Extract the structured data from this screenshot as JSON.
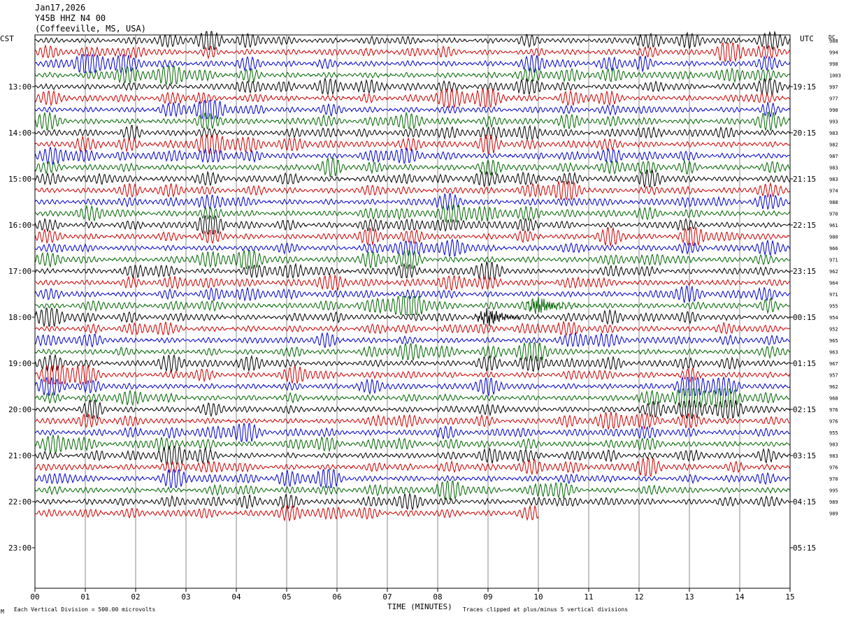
{
  "header": {
    "date": "Jan17,2026",
    "station": "Y45B HHZ N4 00",
    "location": "(Coffeeville, MS, USA)"
  },
  "footer": {
    "scale_note": "Each Vertical Division =  500.00 microvolts",
    "clip_note": "Traces clipped at plus/minus 5 vertical divisions",
    "corner_mark": "M"
  },
  "chart_data": {
    "type": "line",
    "title": "",
    "left_label": "CST",
    "right_label": "UTC",
    "dc_label": "DC",
    "xlabel": "TIME (MINUTES)",
    "xlim": [
      0,
      15
    ],
    "x_ticks": [
      "00",
      "01",
      "02",
      "03",
      "04",
      "05",
      "06",
      "07",
      "08",
      "09",
      "10",
      "11",
      "12",
      "13",
      "14",
      "15"
    ],
    "left_hour_labels": [
      "13:00",
      "14:00",
      "15:00",
      "16:00",
      "17:00",
      "18:00",
      "19:00",
      "20:00",
      "21:00",
      "22:00",
      "23:00"
    ],
    "right_hour_labels": [
      "19:15",
      "20:15",
      "21:15",
      "22:15",
      "23:15",
      "00:15",
      "01:15",
      "02:15",
      "03:15",
      "04:15",
      "05:15"
    ],
    "rows_per_hour": 4,
    "first_row_time": "12:00",
    "trace_colors": [
      "#000000",
      "#cc0000",
      "#0000cc",
      "#006600"
    ],
    "dc_offsets": [
      988,
      994,
      998,
      1003,
      997,
      977,
      990,
      993,
      983,
      982,
      987,
      983,
      983,
      974,
      988,
      970,
      961,
      980,
      966,
      971,
      962,
      964,
      971,
      955,
      954,
      952,
      965,
      963,
      967,
      957,
      962,
      968,
      976,
      976,
      955,
      983,
      983,
      976,
      970,
      995,
      989,
      989
    ],
    "last_row_end_minute": 10,
    "events": [
      {
        "row": 23,
        "minute": 10.0,
        "note": "high-frequency burst"
      },
      {
        "row": 24,
        "minute": 9.0,
        "note": "high-frequency burst"
      }
    ],
    "grid": true
  }
}
